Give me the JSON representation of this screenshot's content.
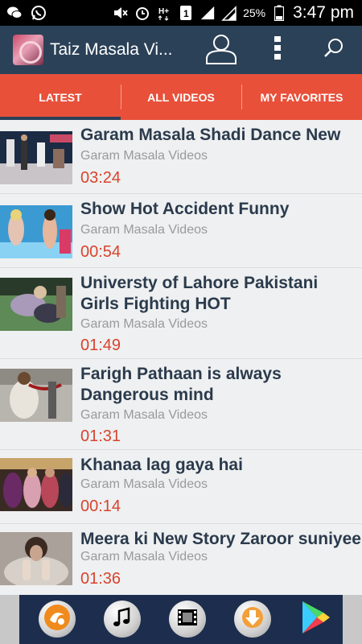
{
  "status_bar": {
    "battery_percent": "25%",
    "time": "3:47 pm",
    "icons": [
      "wechat-icon",
      "whatsapp-icon",
      "mute-icon",
      "alarm-icon",
      "hplus-signal-icon",
      "sim1-icon",
      "signal-icon",
      "battery-icon"
    ]
  },
  "toolbar": {
    "title": "Taiz Masala Vi...",
    "icons": [
      "app-logo",
      "account-icon",
      "overflow-menu-icon",
      "search-icon"
    ]
  },
  "tabs": [
    {
      "label": "LATEST",
      "active": true
    },
    {
      "label": "ALL VIDEOS",
      "active": false
    },
    {
      "label": "MY FAVORITES",
      "active": false
    }
  ],
  "videos": [
    {
      "title_lines": [
        "Garam Masala Shadi Dance New"
      ],
      "channel": "Garam Masala Videos",
      "duration": "03:24"
    },
    {
      "title_lines": [
        "Show Hot Accident Funny"
      ],
      "channel": "Garam Masala Videos",
      "duration": "00:54"
    },
    {
      "title_lines": [
        "Universty of Lahore Pakistani",
        "Girls Fighting HOT"
      ],
      "channel": "Garam Masala Videos",
      "duration": "01:49"
    },
    {
      "title_lines": [
        "Farigh Pathaan is always",
        "Dangerous mind"
      ],
      "channel": "Garam Masala Videos",
      "duration": "01:31"
    },
    {
      "title_lines": [
        "Khanaa lag gaya hai"
      ],
      "channel": "Garam Masala Videos",
      "duration": "00:14"
    },
    {
      "title_lines": [
        "Meera ki New Story Zaroor suniyee"
      ],
      "channel": "Garam Masala Videos",
      "duration": "01:36"
    }
  ],
  "bottom_bar": {
    "icons": [
      "uc-browser-icon",
      "music-icon",
      "video-icon",
      "download-icon",
      "play-store-icon"
    ]
  },
  "colors": {
    "toolbar": "#2b4158",
    "tabs": "#e8503a",
    "duration": "#d9432d",
    "bottom_bar": "#1d2d4d"
  }
}
